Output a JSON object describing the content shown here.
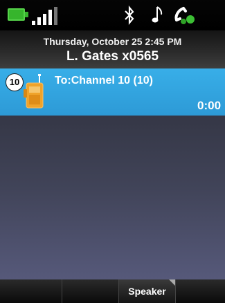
{
  "status_bar": {
    "battery_icon": "battery-icon",
    "signal_icon": "signal-icon",
    "bluetooth_icon": "bluetooth-icon",
    "music_icon": "music-note-icon",
    "handset_icon": "handset-icon"
  },
  "header": {
    "datetime": "Thursday, October 25 2:45 PM",
    "user": "L. Gates x0565"
  },
  "call": {
    "channel_badge": "10",
    "title": "To:Channel 10 (10)",
    "timer": "0:00",
    "icon": "radio-icon"
  },
  "softkeys": [
    {
      "label": ""
    },
    {
      "label": ""
    },
    {
      "label": "Speaker"
    },
    {
      "label": ""
    }
  ],
  "colors": {
    "accent": "#2fa3df",
    "battery": "#36b52c"
  }
}
